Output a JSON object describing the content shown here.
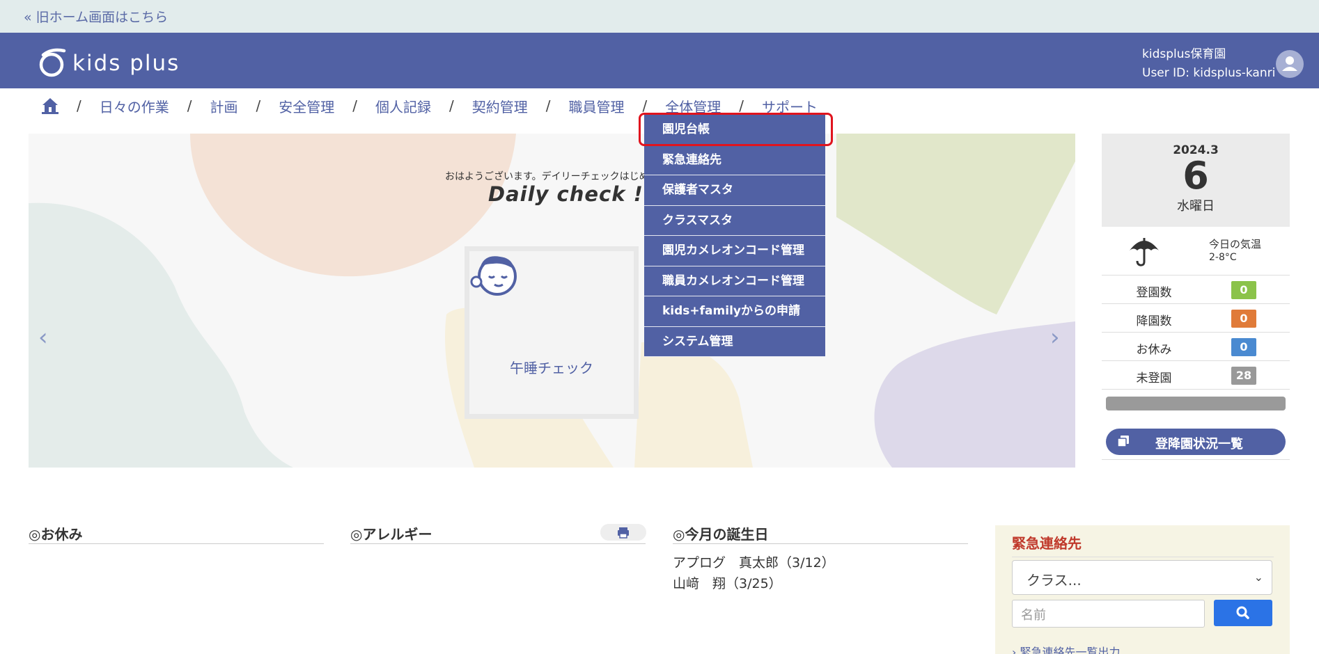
{
  "topbar": {
    "old_home_link": "« 旧ホーム画面はこちら"
  },
  "header": {
    "logo_text": "kids plus",
    "facility_name": "kidsplus保育園",
    "user_id": "User ID: kidsplus-kanri"
  },
  "nav": {
    "items": [
      "日々の作業",
      "計画",
      "安全管理",
      "個人記録",
      "契約管理",
      "職員管理",
      "全体管理",
      "サポート"
    ],
    "separator": "/"
  },
  "dropdown": {
    "items": [
      "園児台帳",
      "緊急連絡先",
      "保護者マスタ",
      "クラスマスタ",
      "園児カメレオンコード管理",
      "職員カメレオンコード管理",
      "kids+familyからの申請",
      "システム管理"
    ]
  },
  "hero": {
    "greeting": "おはようございます。デイリーチェックはじめま",
    "headline": "Daily check !",
    "card_label": "午睡チェック",
    "prev_arrow": "‹",
    "next_arrow": "›"
  },
  "side": {
    "year_month": "2024.3",
    "day": "6",
    "weekday": "水曜日",
    "temp_label": "今日の気温",
    "temp": "2-8°C",
    "stats": [
      {
        "label": "登園数",
        "value": "0",
        "color": "#8bc34a"
      },
      {
        "label": "降園数",
        "value": "0",
        "color": "#e07b39"
      },
      {
        "label": "お休み",
        "value": "0",
        "color": "#4a8ad1"
      },
      {
        "label": "未登園",
        "value": "28",
        "color": "#999999"
      }
    ],
    "list_button": "登降園状況一覧"
  },
  "sections": {
    "absence": "◎お休み",
    "allergy": "◎アレルギー",
    "birthday": "◎今月の誕生日",
    "birthdays": [
      "アプログ　真太郎（3/12）",
      "山﨑　翔（3/25）"
    ]
  },
  "emergency": {
    "title": "緊急連絡先",
    "class_select": "クラス...",
    "name_placeholder": "名前",
    "export_link": "緊急連絡先一覧出力"
  },
  "colors": {
    "brand": "#5161a4",
    "highlight": "#e0141e",
    "search": "#2b73e6"
  }
}
